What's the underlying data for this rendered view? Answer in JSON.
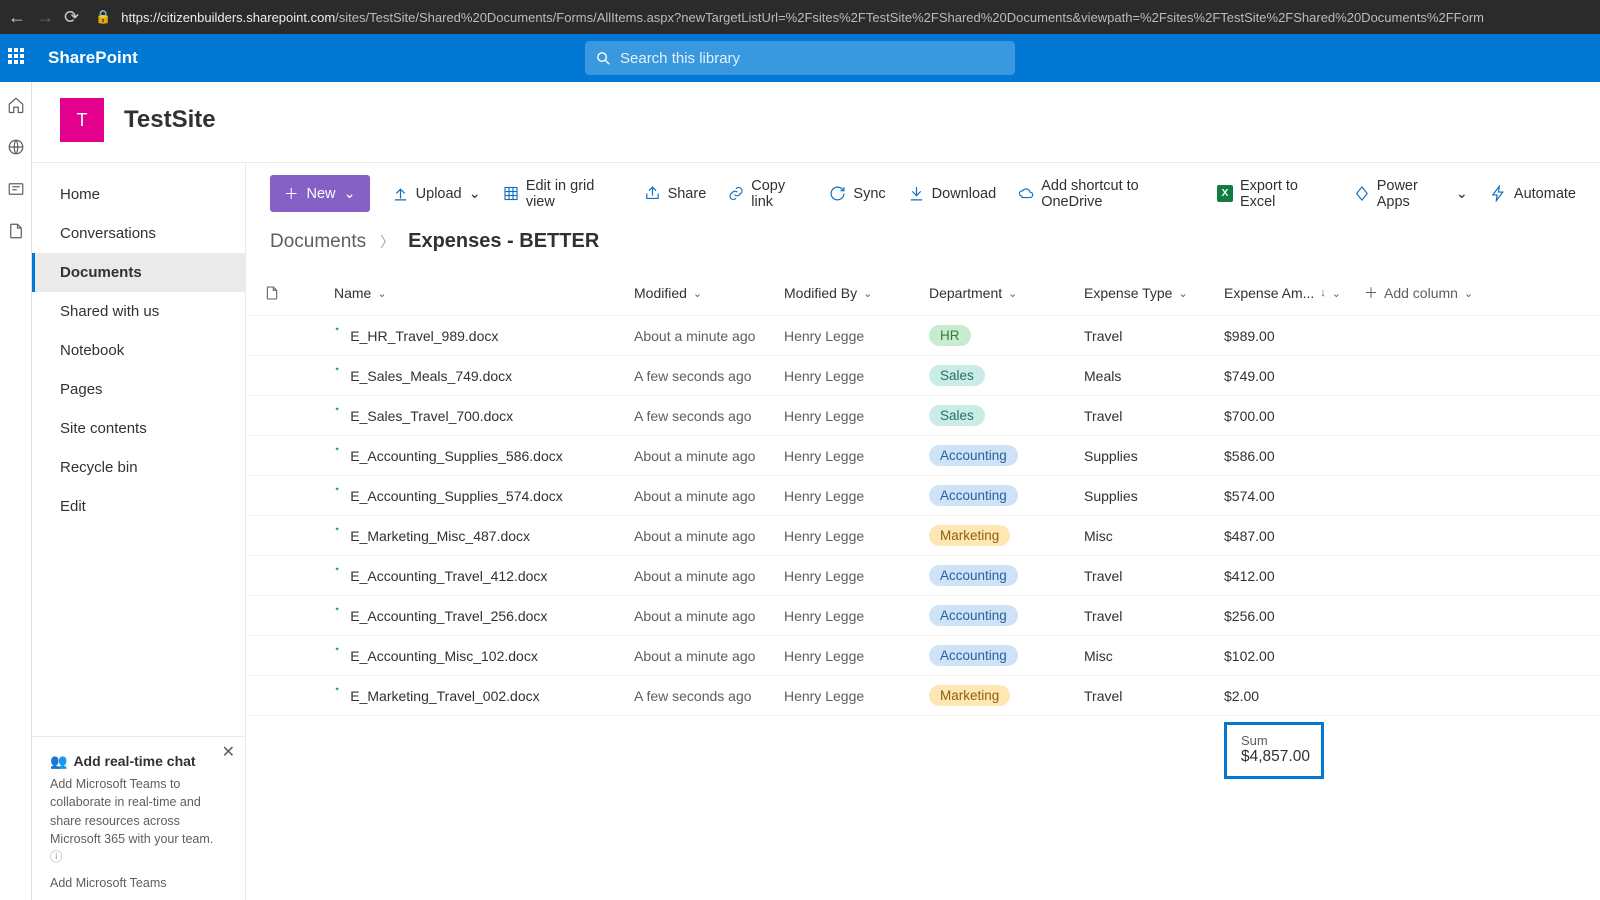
{
  "browser": {
    "url_host": "https://citizenbuilders.sharepoint.com",
    "url_path": "/sites/TestSite/Shared%20Documents/Forms/AllItems.aspx?newTargetListUrl=%2Fsites%2FTestSite%2FShared%20Documents&viewpath=%2Fsites%2FTestSite%2FShared%20Documents%2FForm"
  },
  "suite": {
    "product": "SharePoint",
    "search_placeholder": "Search this library"
  },
  "site": {
    "logo_initial": "T",
    "title": "TestSite"
  },
  "nav": {
    "items": [
      "Home",
      "Conversations",
      "Documents",
      "Shared with us",
      "Notebook",
      "Pages",
      "Site contents",
      "Recycle bin",
      "Edit"
    ],
    "active_index": 2
  },
  "promo": {
    "title": "Add real-time chat",
    "body": "Add Microsoft Teams to collaborate in real-time and share resources across Microsoft 365 with your team.",
    "link": "Add Microsoft Teams"
  },
  "commands": {
    "new": "New",
    "upload": "Upload",
    "editGrid": "Edit in grid view",
    "share": "Share",
    "copyLink": "Copy link",
    "sync": "Sync",
    "download": "Download",
    "addShortcut": "Add shortcut to OneDrive",
    "exportExcel": "Export to Excel",
    "powerApps": "Power Apps",
    "automate": "Automate"
  },
  "breadcrumb": {
    "root": "Documents",
    "current": "Expenses - BETTER"
  },
  "columns": {
    "name": "Name",
    "modified": "Modified",
    "modifiedBy": "Modified By",
    "department": "Department",
    "expenseType": "Expense Type",
    "expenseAmount": "Expense Am...",
    "add": "Add column"
  },
  "rows": [
    {
      "name": "E_HR_Travel_989.docx",
      "modified": "About a minute ago",
      "by": "Henry Legge",
      "dept": "HR",
      "type": "Travel",
      "amount": "$989.00"
    },
    {
      "name": "E_Sales_Meals_749.docx",
      "modified": "A few seconds ago",
      "by": "Henry Legge",
      "dept": "Sales",
      "type": "Meals",
      "amount": "$749.00"
    },
    {
      "name": "E_Sales_Travel_700.docx",
      "modified": "A few seconds ago",
      "by": "Henry Legge",
      "dept": "Sales",
      "type": "Travel",
      "amount": "$700.00"
    },
    {
      "name": "E_Accounting_Supplies_586.docx",
      "modified": "About a minute ago",
      "by": "Henry Legge",
      "dept": "Accounting",
      "type": "Supplies",
      "amount": "$586.00"
    },
    {
      "name": "E_Accounting_Supplies_574.docx",
      "modified": "About a minute ago",
      "by": "Henry Legge",
      "dept": "Accounting",
      "type": "Supplies",
      "amount": "$574.00"
    },
    {
      "name": "E_Marketing_Misc_487.docx",
      "modified": "About a minute ago",
      "by": "Henry Legge",
      "dept": "Marketing",
      "type": "Misc",
      "amount": "$487.00"
    },
    {
      "name": "E_Accounting_Travel_412.docx",
      "modified": "About a minute ago",
      "by": "Henry Legge",
      "dept": "Accounting",
      "type": "Travel",
      "amount": "$412.00"
    },
    {
      "name": "E_Accounting_Travel_256.docx",
      "modified": "About a minute ago",
      "by": "Henry Legge",
      "dept": "Accounting",
      "type": "Travel",
      "amount": "$256.00"
    },
    {
      "name": "E_Accounting_Misc_102.docx",
      "modified": "About a minute ago",
      "by": "Henry Legge",
      "dept": "Accounting",
      "type": "Misc",
      "amount": "$102.00"
    },
    {
      "name": "E_Marketing_Travel_002.docx",
      "modified": "A few seconds ago",
      "by": "Henry Legge",
      "dept": "Marketing",
      "type": "Travel",
      "amount": "$2.00"
    }
  ],
  "summary": {
    "label": "Sum",
    "value": "$4,857.00"
  }
}
